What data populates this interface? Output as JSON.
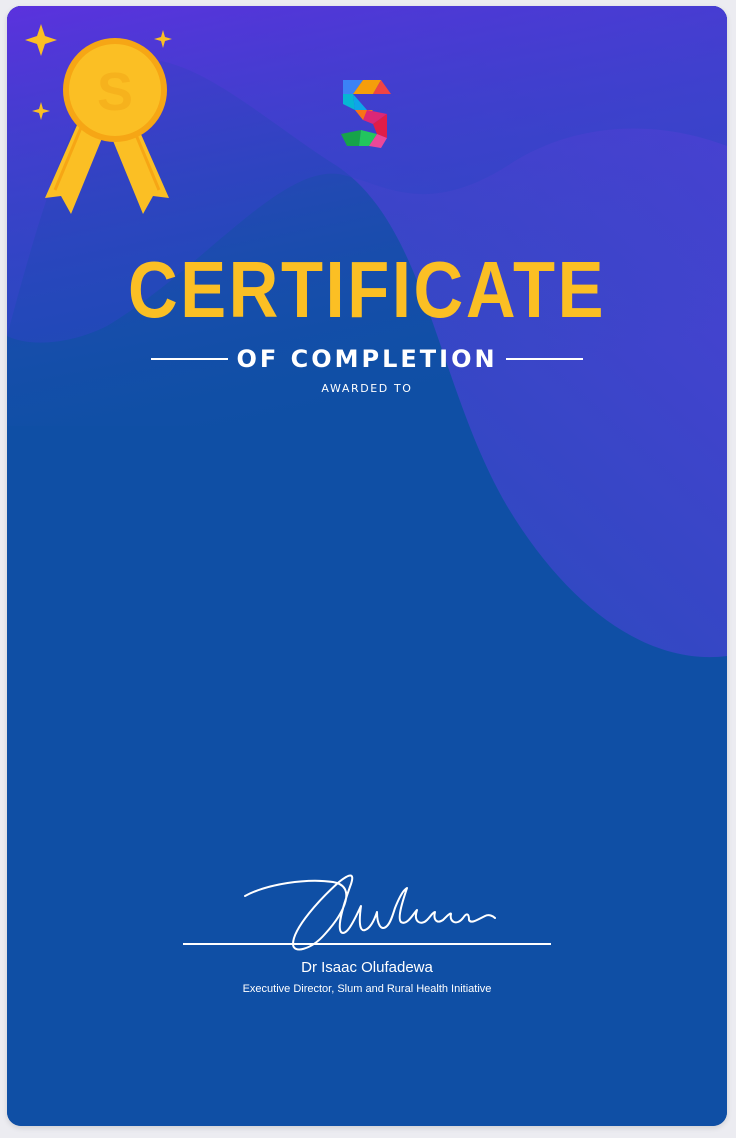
{
  "certificate": {
    "title": "CERTIFICATE",
    "subtitle": "OF  COMPLETION",
    "awarded_label": "AWARDED TO",
    "signer_name": "Dr Isaac Olufadewa",
    "signer_title": "Executive Director, Slum and Rural Health Initiative",
    "signature_text": "Olufadewa"
  },
  "icons": {
    "medal": "medal-icon",
    "logo": "logo-icon",
    "sparkle": "sparkle-icon"
  },
  "colors": {
    "background": "#0f4fa5",
    "gradient_top": "#6a2be6",
    "title": "#fbbf24",
    "text": "#ffffff",
    "medal": "#fbbf24"
  }
}
